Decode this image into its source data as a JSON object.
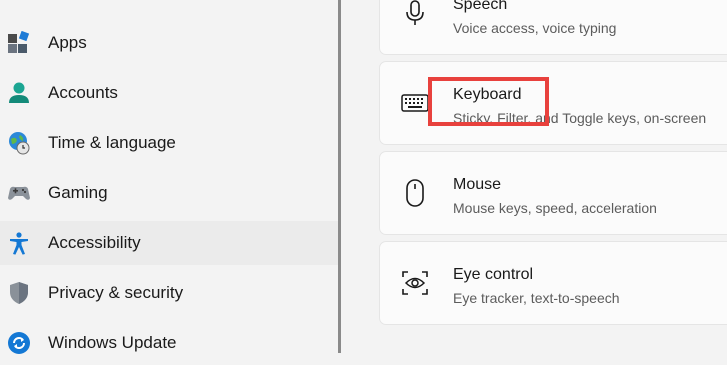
{
  "sidebar": {
    "items": [
      {
        "label": "Apps",
        "icon": "apps-icon"
      },
      {
        "label": "Accounts",
        "icon": "accounts-icon"
      },
      {
        "label": "Time & language",
        "icon": "time-language-icon"
      },
      {
        "label": "Gaming",
        "icon": "gaming-controller-icon"
      },
      {
        "label": "Accessibility",
        "icon": "accessibility-icon"
      },
      {
        "label": "Privacy & security",
        "icon": "shield-icon"
      },
      {
        "label": "Windows Update",
        "icon": "windows-update-icon"
      }
    ]
  },
  "cards": [
    {
      "title": "Speech",
      "subtitle": "Voice access, voice typing",
      "icon": "microphone-icon"
    },
    {
      "title": "Keyboard",
      "subtitle": "Sticky, Filter, and Toggle keys, on-screen",
      "icon": "keyboard-icon"
    },
    {
      "title": "Mouse",
      "subtitle": "Mouse keys, speed, acceleration",
      "icon": "mouse-icon"
    },
    {
      "title": "Eye control",
      "subtitle": "Eye tracker, text-to-speech",
      "icon": "eye-control-icon"
    }
  ],
  "colors": {
    "highlight": "#e8413d",
    "accent": "#0f6cbd"
  }
}
